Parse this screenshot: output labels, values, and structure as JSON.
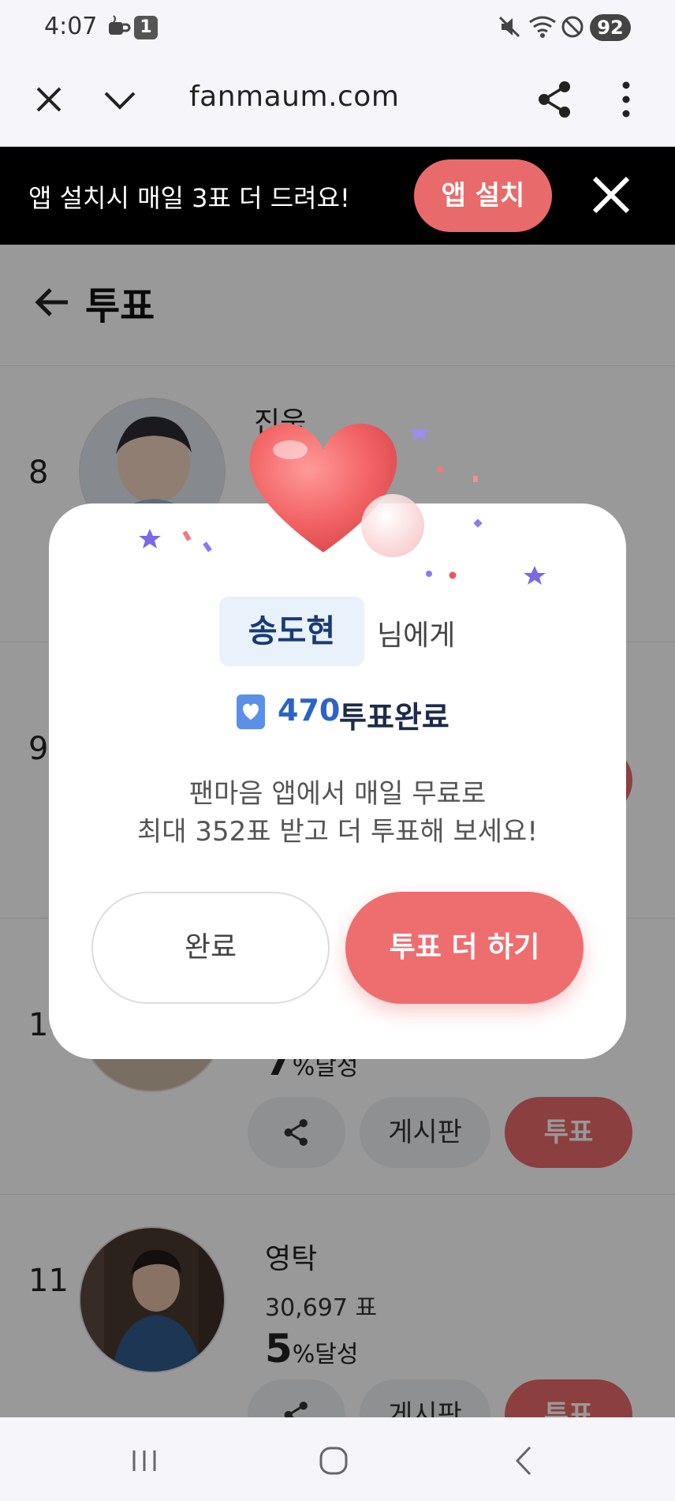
{
  "status_bar": {
    "time": "4:07",
    "notification_count": "1",
    "battery": "92"
  },
  "browser": {
    "url": "fanmaum.com"
  },
  "promo": {
    "text": "앱 설치시 매일 3표 더 드려요!",
    "install_label": "앱 설치"
  },
  "page": {
    "title": "투표",
    "rows": [
      {
        "rank": "8",
        "name": "진욱"
      },
      {
        "rank": "9"
      },
      {
        "rank": "10",
        "percent": "7",
        "percent_unit": "%달성",
        "share_label": "",
        "board_label": "게시판",
        "vote_label": "투표"
      },
      {
        "rank": "11",
        "name": "영탁",
        "votes": "30,697 표",
        "percent": "5",
        "percent_unit": "%달성",
        "board_label": "게시판",
        "vote_label": "투표"
      }
    ]
  },
  "modal": {
    "recipient": "송도현",
    "recipient_suffix": "님에게",
    "vote_count": "470",
    "vote_done_text": "투표완료",
    "desc_line1": "팬마음 앱에서 매일 무료로",
    "desc_line2": "최대 352표 받고 더 투표해 보세요!",
    "done_button": "완료",
    "more_button": "투표 더 하기"
  },
  "colors": {
    "accent": "#e86a6a",
    "primary_blue": "#2a63c9"
  }
}
